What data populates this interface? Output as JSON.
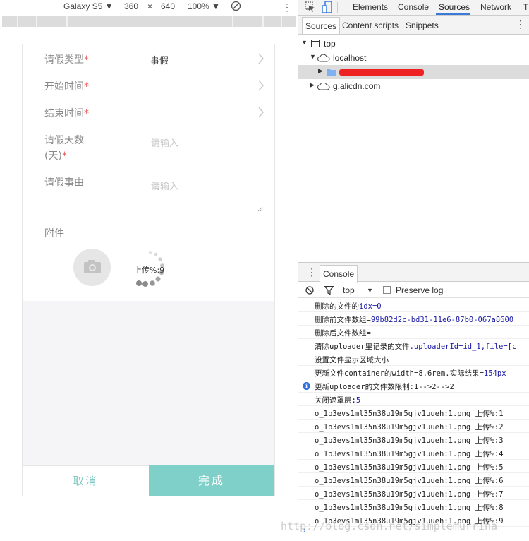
{
  "device_toolbar": {
    "device": "Galaxy S5 ▼",
    "width": "360",
    "times": "×",
    "height": "640",
    "zoom": "100% ▼"
  },
  "form": {
    "leave_type": {
      "label": "请假类型",
      "required_mark": "*",
      "value": "事假"
    },
    "start_time": {
      "label": "开始时间",
      "required_mark": "*"
    },
    "end_time": {
      "label": "结束时间",
      "required_mark": "*"
    },
    "days": {
      "label_line1": "请假天数",
      "label_line2": "(天)",
      "required_mark": "*",
      "placeholder": "请输入"
    },
    "reason": {
      "label": "请假事由",
      "placeholder": "请输入"
    },
    "attachment": {
      "label": "附件"
    },
    "upload_progress": "上传%:9"
  },
  "buttons": {
    "cancel": "取消",
    "done": "完成"
  },
  "devtools": {
    "tabs": [
      "Elements",
      "Console",
      "Sources",
      "Network",
      "T"
    ],
    "active_tab": "Sources",
    "sources_subtabs": [
      "Sources",
      "Content scripts",
      "Snippets"
    ],
    "tree": {
      "top": "top",
      "localhost": "localhost",
      "cdn": "g.alicdn.com"
    },
    "console": {
      "tab": "Console",
      "context": "top",
      "preserve_log": "Preserve log",
      "lines": [
        {
          "text": "删除的文件的",
          "value": "idx=0"
        },
        {
          "text": "删除前文件数组=",
          "value": "99b82d2c-bd31-11e6-87b0-067a8600"
        },
        {
          "text": "删除后文件数组=",
          "value": ""
        },
        {
          "text": "清除uploader里记录的文件",
          "value": ".uploaderId=id_1,file=[c"
        },
        {
          "text": "设置文件显示区域大小",
          "value": ""
        },
        {
          "text": "更新文件container的width=8.6rem.实际结果=",
          "value": "154px"
        },
        {
          "text": "更新uploader的文件数限制:1-->2-->2",
          "value": "",
          "info": true
        },
        {
          "text": "关闭遮罩层:",
          "value": "5"
        },
        {
          "text": "o_1b3evs1ml35n38u19m5gjv1uueh:1.png 上传%:1",
          "value": ""
        },
        {
          "text": "o_1b3evs1ml35n38u19m5gjv1uueh:1.png 上传%:2",
          "value": ""
        },
        {
          "text": "o_1b3evs1ml35n38u19m5gjv1uueh:1.png 上传%:3",
          "value": ""
        },
        {
          "text": "o_1b3evs1ml35n38u19m5gjv1uueh:1.png 上传%:4",
          "value": ""
        },
        {
          "text": "o_1b3evs1ml35n38u19m5gjv1uueh:1.png 上传%:5",
          "value": ""
        },
        {
          "text": "o_1b3evs1ml35n38u19m5gjv1uueh:1.png 上传%:6",
          "value": ""
        },
        {
          "text": "o_1b3evs1ml35n38u19m5gjv1uueh:1.png 上传%:7",
          "value": ""
        },
        {
          "text": "o_1b3evs1ml35n38u19m5gjv1uueh:1.png 上传%:8",
          "value": ""
        },
        {
          "text": "o_1b3evs1ml35n38u19m5gjv1uueh:1.png 上传%:9",
          "value": ""
        }
      ],
      "prompt": "›"
    }
  },
  "watermark": "http://blog.csdn.net/simplemurrina",
  "colors": {
    "accent": "#7fd0c9",
    "required": "#e95a5a",
    "devtools_blue": "#3879d9"
  }
}
